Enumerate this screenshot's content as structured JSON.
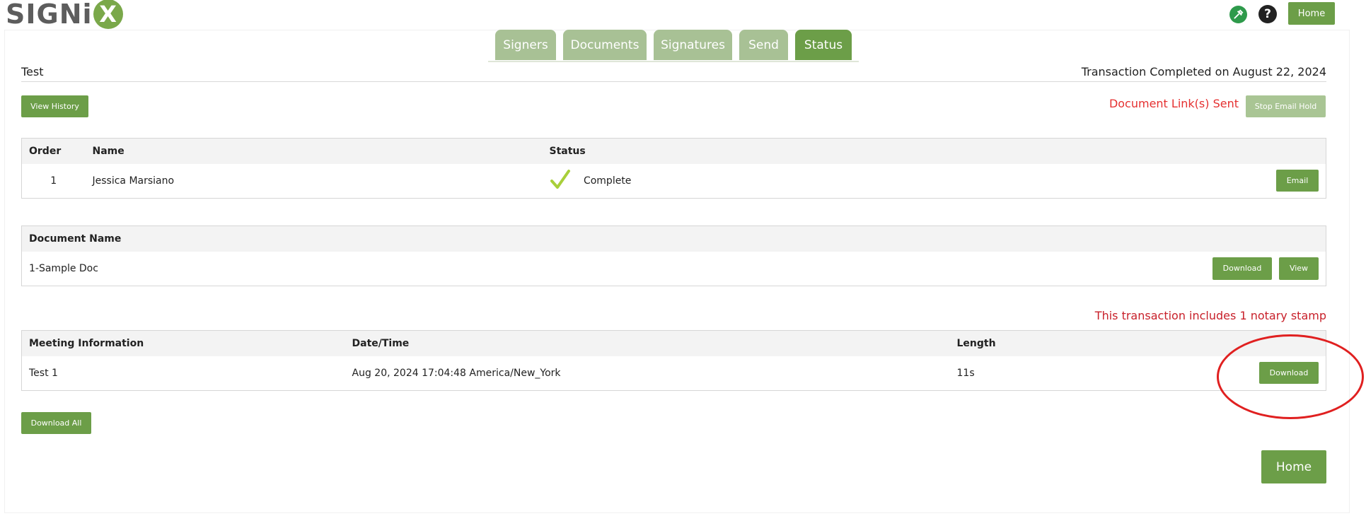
{
  "brand": {
    "logo_text": "SIGNi",
    "logo_x": "X"
  },
  "header": {
    "home_label": "Home",
    "tools_icon": "tools-icon",
    "help_icon": "help-icon"
  },
  "tabs": [
    {
      "label": "Signers",
      "active": false
    },
    {
      "label": "Documents",
      "active": false
    },
    {
      "label": "Signatures",
      "active": false
    },
    {
      "label": "Send",
      "active": false
    },
    {
      "label": "Status",
      "active": true
    }
  ],
  "transaction": {
    "title": "Test",
    "completed_text": "Transaction Completed on August 22, 2024",
    "view_history_label": "View History",
    "links_sent_text": "Document Link(s) Sent",
    "stop_email_hold_label": "Stop Email Hold"
  },
  "signers_table": {
    "headers": [
      "Order",
      "Name",
      "Status"
    ],
    "rows": [
      {
        "order": "1",
        "name": "Jessica Marsiano",
        "status": "Complete",
        "email_label": "Email"
      }
    ]
  },
  "documents_table": {
    "headers": [
      "Document Name"
    ],
    "rows": [
      {
        "name": "1-Sample Doc",
        "download_label": "Download",
        "view_label": "View"
      }
    ]
  },
  "notary": {
    "stamp_text": "This transaction includes 1 notary stamp"
  },
  "meeting_table": {
    "headers": [
      "Meeting Information",
      "Date/Time",
      "Length"
    ],
    "rows": [
      {
        "info": "Test 1",
        "datetime": "Aug 20, 2024 17:04:48 America/New_York",
        "length": "11s",
        "download_label": "Download"
      }
    ]
  },
  "footer": {
    "download_all_label": "Download All",
    "home_label": "Home"
  },
  "colors": {
    "accent": "#6c9e48",
    "tab_inactive": "#a8c195",
    "alert_red": "#e53030",
    "check": "#a8cf3a"
  }
}
